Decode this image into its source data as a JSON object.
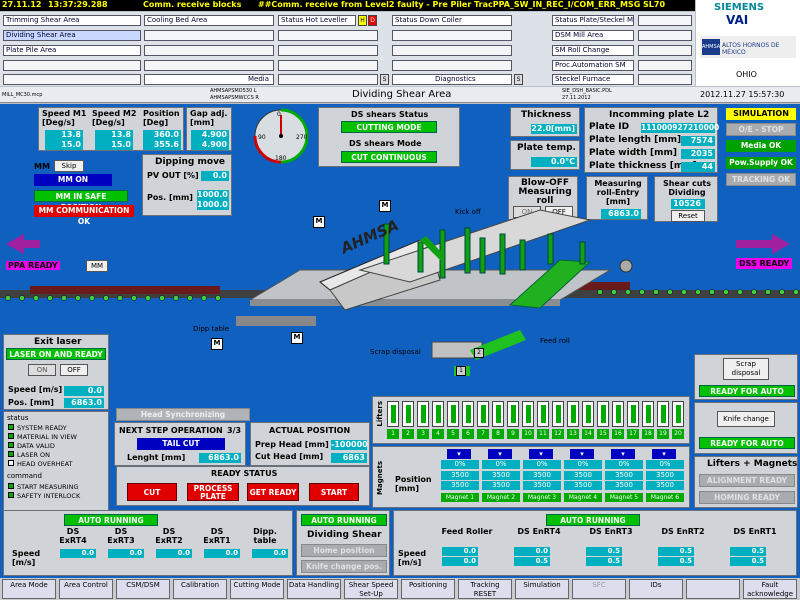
{
  "alarm": {
    "date": "27.11.12",
    "time": "13:37:29.288",
    "msg1": "Comm. receive blocks",
    "msg2": "##Comm. receive from Level2 faulty - Pre Piler TracPPA_SW_IN_REC_I/COM_ERR_MSG SL70"
  },
  "nav": {
    "col1": [
      "Trimming Shear Area",
      "Dividing Shear Area",
      "Plate Pile Area",
      "",
      ""
    ],
    "col2": [
      "",
      "",
      "",
      "",
      "Media"
    ],
    "col2b": [
      "Cooling Bed Area",
      "",
      "",
      "",
      ""
    ],
    "col3": [
      "Status Hot Leveller",
      "",
      "",
      "",
      ""
    ],
    "col3b": [
      "Status Down Coiler",
      "",
      "",
      "",
      "Diagnostics"
    ],
    "col4": [
      "Status Plate/Steckel Mill",
      "DSM Mill Area",
      "SM Roll Change",
      "Proc.Automation SM",
      "Steckel Furnace"
    ],
    "small": [
      "H",
      "D",
      "S",
      "S"
    ]
  },
  "logos": {
    "siemens": "SIEMENS",
    "vai": "VAI",
    "ahmsa": "ALTOS HORNOS DE MÉXICO",
    "site": "OHIO"
  },
  "infobar": {
    "left": "MILL_MC30.mcp",
    "mid1": "AHMSAPSMO530  L",
    "mid2": "AHMSAPSMWCCS  R",
    "title": "Dividing Shear Area",
    "r1": "SIE_DSH_BASIC.PDL",
    "r2": "27.11.2012",
    "datetime": "2012.11.27  15:57:30"
  },
  "speeds": {
    "h1": "Speed M1 [Deg/s]",
    "h2": "Speed M2 [Deg/s]",
    "h3": "Position [Deg]",
    "m1a": "13.8",
    "m1b": "15.0",
    "m2a": "13.8",
    "m2b": "15.0",
    "pa": "360.0",
    "pb": "355.6"
  },
  "gap": {
    "label": "Gap adj. [mm]",
    "a": "4.900",
    "b": "4.900"
  },
  "dial": {
    "t0": "0",
    "t90": "90",
    "t180": "180",
    "t270": "270"
  },
  "dsstatus": {
    "title": "DS shears Status",
    "status": "CUTTING MODE",
    "mode_title": "DS shears Mode",
    "mode": "CUT CONTINUOUS"
  },
  "thickness": {
    "label": "Thickness",
    "val": "22.0[mm]"
  },
  "platetemp": {
    "label": "Plate temp.",
    "val": "0.0°C"
  },
  "l2": {
    "title": "Incomming plate L2",
    "id_l": "Plate ID",
    "id": "111000927210000",
    "len_l": "Plate length [mm]",
    "len": "7574",
    "wid_l": "Plate width [mm]",
    "wid": "2035",
    "th_l": "Plate thickness [mm]",
    "th": "44"
  },
  "right": {
    "sim": "SIMULATION",
    "oe": "O/E - STOP",
    "media": "Media OK",
    "pow": "Pow.Supply OK",
    "track": "TRACKING OK"
  },
  "mm": {
    "label": "MM",
    "skip": "Skip",
    "on": "MM ON",
    "safe": "MM IN SAFE POSITION",
    "comm": "MM COMMUNICATION OK"
  },
  "dipping": {
    "title": "Dipping move",
    "pv": "PV OUT [%]",
    "pv_v": "0.0",
    "pos": "Pos. [mm]",
    "pos_a": "1000.0",
    "pos_b": "1000.0"
  },
  "blowoff": {
    "title": "Blow-OFF Measuring roll",
    "on": "ON",
    "off": "OFF"
  },
  "meas": {
    "title": "Measuring roll-Entry [mm]",
    "val": "6863.0"
  },
  "shearcuts": {
    "title": "Shear cuts Dividing",
    "val": "10526",
    "reset": "Reset"
  },
  "scene": {
    "ppa": "PPA READY",
    "dss": "DSS READY",
    "mm": "MM",
    "kick": "Kick off",
    "dipp": "Dipp table",
    "scrap": "Scrap disposal",
    "feed": "Feed roll",
    "logo": "AHMSA",
    "tags": [
      "1",
      "M",
      "M",
      "M",
      "M",
      "2",
      "1"
    ]
  },
  "exitlaser": {
    "title": "Exit laser",
    "status": "LASER ON AND READY",
    "on": "ON",
    "off": "OFF",
    "speed_l": "Speed [m/s]",
    "speed": "0.0",
    "pos_l": "Pos. [mm]",
    "pos": "6863.0"
  },
  "statuslist": {
    "title": "status",
    "items": [
      "SYSTEM READY",
      "MATERIAL IN VIEW",
      "DATA VALID",
      "LASER ON",
      "HEAD OVERHEAT"
    ],
    "cmd_title": "command",
    "cmds": [
      "START MEASURING",
      "SAFETY INTERLOCK"
    ]
  },
  "headsync": {
    "label": "Head Synchronizing"
  },
  "nextstep": {
    "title": "NEXT STEP OPERATION",
    "count": "3/3",
    "op": "TAIL CUT",
    "len_l": "Lenght [mm]",
    "len": "6863.0"
  },
  "actual": {
    "title": "ACTUAL POSITION",
    "prep_l": "Prep Head [mm]",
    "prep": "-100000",
    "cut_l": "Cut Head [mm]",
    "cut": "6863"
  },
  "ready": {
    "title": "READY STATUS",
    "b": [
      "CUT",
      "PROCESS PLATE",
      "GET READY",
      "START"
    ]
  },
  "lifters": {
    "label": "Lifters",
    "n": [
      "1",
      "2",
      "3",
      "4",
      "5",
      "6",
      "7",
      "8",
      "9",
      "10",
      "11",
      "12",
      "13",
      "14",
      "15",
      "16",
      "17",
      "18",
      "19",
      "20"
    ]
  },
  "magnets": {
    "label": "Magnets",
    "pos_l": "Position [mm]",
    "pct": [
      "0%",
      "0%",
      "0%",
      "0%",
      "0%",
      "0%"
    ],
    "a": [
      "3500",
      "3500",
      "3500",
      "3500",
      "3500",
      "3500"
    ],
    "b": [
      "3500",
      "3500",
      "3500",
      "3500",
      "3500",
      "3500"
    ],
    "names": [
      "Magnet 1",
      "Magnet 2",
      "Magnet 3",
      "Magnet 4",
      "Magnet 5",
      "Magnet 6"
    ]
  },
  "scrapr": {
    "btn": "Scrap disposal",
    "ready": "READY FOR AUTO"
  },
  "knife": {
    "btn": "Knife change",
    "ready": "READY FOR AUTO"
  },
  "liftmag": {
    "title": "Lifters + Magnets",
    "a": "ALIGNMENT READY",
    "h": "HOMING READY"
  },
  "drives1": {
    "state": "AUTO RUNNING",
    "speed_l": "Speed [m/s]",
    "cols": [
      {
        "n": "DS ExRT4",
        "v": "0.0"
      },
      {
        "n": "DS ExRT3",
        "v": "0.0"
      },
      {
        "n": "DS ExRT2",
        "v": "0.0"
      },
      {
        "n": "DS ExRT1",
        "v": "0.0"
      },
      {
        "n": "Dipp. table",
        "v": "0.0"
      }
    ]
  },
  "drives2": {
    "state": "AUTO RUNNING",
    "title": "Dividing Shear",
    "home": "Home position",
    "knife": "Knife change pos."
  },
  "drives3": {
    "state": "AUTO RUNNING",
    "speed_l": "Speed [m/s]",
    "cols": [
      {
        "n": "Feed Roller",
        "v": "0.0"
      },
      {
        "n": "DS EnRT4",
        "v": "0.5"
      },
      {
        "n": "DS EnRT3",
        "v": "0.5"
      },
      {
        "n": "DS EnRT2",
        "v": "0.5"
      },
      {
        "n": "DS EnRT1",
        "v": "0.5"
      }
    ],
    "top": [
      "0.0",
      "0.0",
      "0.5",
      "0.5",
      "0.5"
    ]
  },
  "bottom": [
    "Area Mode",
    "Area Control",
    "CSM/DSM",
    "Calibration",
    "Cutting Mode",
    "Data Handling",
    "Shear Speed Set-Up",
    "Positioning",
    "Tracking RESET",
    "Simulation",
    "SFC",
    "IDs",
    "",
    "Fault acknowledge"
  ]
}
